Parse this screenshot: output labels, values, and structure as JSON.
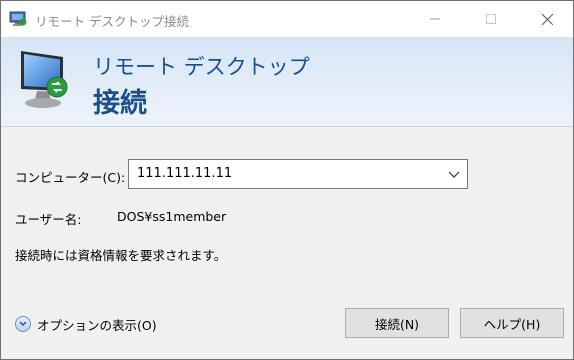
{
  "window": {
    "title": "リモート デスクトップ接続",
    "controls": {
      "minimize": "—",
      "maximize": "☐",
      "close": "✕"
    }
  },
  "banner": {
    "line1": "リモート デスクトップ",
    "line2": "接続",
    "icon": "remote-desktop-monitor-icon"
  },
  "form": {
    "computer_label": "コンピューター(C):",
    "computer_value": "111.111.11.11",
    "username_label": "ユーザー名:",
    "username_value": "DOS¥ss1member",
    "credentials_note": "接続時には資格情報を要求されます。"
  },
  "footer": {
    "options_label": "オプションの表示(O)",
    "connect_button": "接続(N)",
    "help_button": "ヘルプ(H)"
  },
  "colors": {
    "banner_text": "#1a4f8f",
    "dialog_bg": "#f0f0f0",
    "button_bg": "#e1e1e1"
  }
}
